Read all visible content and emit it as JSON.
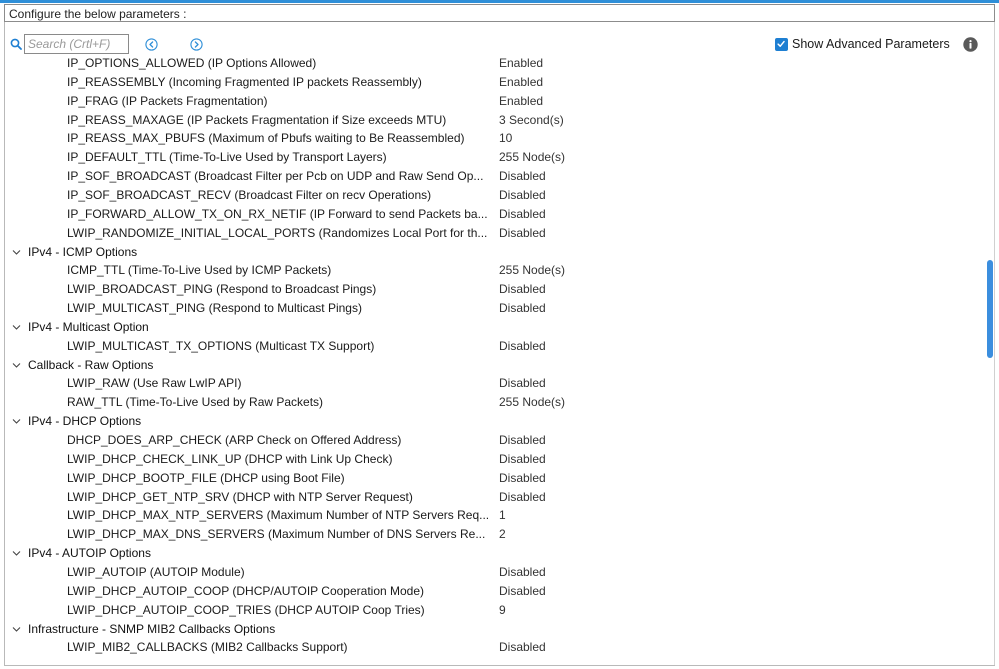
{
  "header": {
    "configure_label": "Configure the below parameters :"
  },
  "toolbar": {
    "search_placeholder": "Search (Crtl+F)",
    "show_advanced_label": "Show Advanced Parameters",
    "show_advanced_checked": true
  },
  "colors": {
    "accent": "#2f8fd8",
    "checkbox": "#1e7fd2",
    "scroll_thumb": "#3b8ede"
  },
  "icons": {
    "search": "search-icon",
    "prev": "chevron-left-circle-icon",
    "next": "chevron-right-circle-icon",
    "info": "info-icon",
    "group": "chevron-down-icon"
  },
  "rows": [
    {
      "type": "param",
      "name": "IP_OPTIONS_ALLOWED (IP Options Allowed)",
      "value": "Enabled"
    },
    {
      "type": "param",
      "name": "IP_REASSEMBLY (Incoming Fragmented IP packets Reassembly)",
      "value": "Enabled"
    },
    {
      "type": "param",
      "name": "IP_FRAG (IP Packets Fragmentation)",
      "value": "Enabled"
    },
    {
      "type": "param",
      "name": "IP_REASS_MAXAGE (IP Packets Fragmentation if Size exceeds MTU)",
      "value": "3 Second(s)"
    },
    {
      "type": "param",
      "name": "IP_REASS_MAX_PBUFS (Maximum of Pbufs waiting to Be Reassembled)",
      "value": "10"
    },
    {
      "type": "param",
      "name": "IP_DEFAULT_TTL (Time-To-Live Used by Transport Layers)",
      "value": "255 Node(s)"
    },
    {
      "type": "param",
      "name": "IP_SOF_BROADCAST (Broadcast Filter per Pcb on UDP and Raw Send Op...",
      "value": "Disabled"
    },
    {
      "type": "param",
      "name": "IP_SOF_BROADCAST_RECV (Broadcast Filter on recv Operations)",
      "value": "Disabled"
    },
    {
      "type": "param",
      "name": "IP_FORWARD_ALLOW_TX_ON_RX_NETIF (IP Forward to send Packets ba...",
      "value": "Disabled"
    },
    {
      "type": "param",
      "name": "LWIP_RANDOMIZE_INITIAL_LOCAL_PORTS (Randomizes Local Port for th...",
      "value": "Disabled"
    },
    {
      "type": "group",
      "name": "IPv4 - ICMP Options"
    },
    {
      "type": "param",
      "name": "ICMP_TTL (Time-To-Live Used by ICMP Packets)",
      "value": "255 Node(s)"
    },
    {
      "type": "param",
      "name": "LWIP_BROADCAST_PING (Respond to Broadcast Pings)",
      "value": "Disabled"
    },
    {
      "type": "param",
      "name": "LWIP_MULTICAST_PING (Respond to Multicast Pings)",
      "value": "Disabled"
    },
    {
      "type": "group",
      "name": "IPv4 - Multicast Option"
    },
    {
      "type": "param",
      "name": "LWIP_MULTICAST_TX_OPTIONS (Multicast TX Support)",
      "value": "Disabled"
    },
    {
      "type": "group",
      "name": "Callback - Raw Options"
    },
    {
      "type": "param",
      "name": "LWIP_RAW (Use Raw LwIP API)",
      "value": "Disabled"
    },
    {
      "type": "param",
      "name": "RAW_TTL (Time-To-Live Used by Raw Packets)",
      "value": "255 Node(s)"
    },
    {
      "type": "group",
      "name": "IPv4 - DHCP Options"
    },
    {
      "type": "param",
      "name": "DHCP_DOES_ARP_CHECK (ARP Check on Offered Address)",
      "value": "Disabled"
    },
    {
      "type": "param",
      "name": "LWIP_DHCP_CHECK_LINK_UP (DHCP with Link Up Check)",
      "value": "Disabled"
    },
    {
      "type": "param",
      "name": "LWIP_DHCP_BOOTP_FILE (DHCP using Boot File)",
      "value": "Disabled"
    },
    {
      "type": "param",
      "name": "LWIP_DHCP_GET_NTP_SRV (DHCP with NTP Server Request)",
      "value": "Disabled"
    },
    {
      "type": "param",
      "name": "LWIP_DHCP_MAX_NTP_SERVERS (Maximum Number of NTP Servers Req...",
      "value": "1"
    },
    {
      "type": "param",
      "name": "LWIP_DHCP_MAX_DNS_SERVERS (Maximum Number of DNS Servers Re...",
      "value": "2"
    },
    {
      "type": "group",
      "name": "IPv4 - AUTOIP Options"
    },
    {
      "type": "param",
      "name": "LWIP_AUTOIP (AUTOIP Module)",
      "value": "Disabled"
    },
    {
      "type": "param",
      "name": "LWIP_DHCP_AUTOIP_COOP (DHCP/AUTOIP Cooperation Mode)",
      "value": "Disabled"
    },
    {
      "type": "param",
      "name": "LWIP_DHCP_AUTOIP_COOP_TRIES (DHCP AUTOIP Coop Tries)",
      "value": "9"
    },
    {
      "type": "group",
      "name": "Infrastructure - SNMP MIB2 Callbacks Options"
    },
    {
      "type": "param",
      "name": "LWIP_MIB2_CALLBACKS (MIB2 Callbacks Support)",
      "value": "Disabled"
    }
  ]
}
